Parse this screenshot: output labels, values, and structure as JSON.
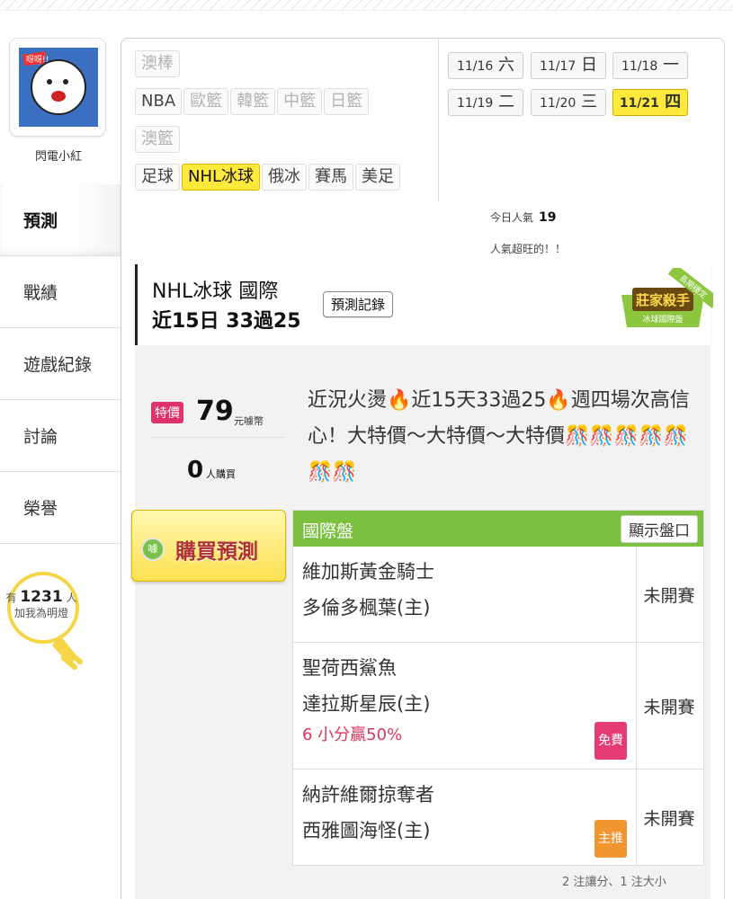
{
  "user": {
    "name": "閃電小紅"
  },
  "nav": [
    "預測",
    "戰績",
    "遊戲紀錄",
    "討論",
    "榮譽"
  ],
  "bulb": {
    "prefix": "有",
    "count": "1231",
    "suffix": "人",
    "label": "加我為明燈"
  },
  "leagues": {
    "row1": [
      "澳棒"
    ],
    "row2": [
      "NBA",
      "歐籃",
      "韓籃",
      "中籃",
      "日籃"
    ],
    "row3": [
      "澳籃"
    ],
    "row4": [
      "足球",
      "NHL冰球",
      "俄冰",
      "賽馬",
      "美足"
    ]
  },
  "dates": [
    {
      "d": "11/16",
      "w": "六"
    },
    {
      "d": "11/17",
      "w": "日"
    },
    {
      "d": "11/18",
      "w": "一"
    },
    {
      "d": "11/19",
      "w": "二"
    },
    {
      "d": "11/20",
      "w": "三"
    },
    {
      "d": "11/21",
      "w": "四"
    }
  ],
  "popularity": {
    "label": "今日人氣",
    "value": "19",
    "note": "人氣超旺的！！"
  },
  "title": {
    "line1": "NHL冰球 國際",
    "line2": "近15日 33過25",
    "record_button": "預測記錄",
    "badge_main": "莊家殺手",
    "badge_sub": "冰球國際盤",
    "badge_ribbon": "長期穩定"
  },
  "price": {
    "tag": "特價",
    "value": "79",
    "unit": "元噱幣",
    "buyers": "0",
    "buyers_unit": "人購買"
  },
  "description": "近況火燙🔥近15天33過25🔥週四場次高信心！大特價～大特價～大特價🎊🎊🎊🎊🎊🎊🎊",
  "buy_button": "購買預測",
  "table": {
    "header": "國際盤",
    "show_button": "顯示盤口",
    "rows": [
      {
        "away": "維加斯黃金騎士",
        "home": "多倫多楓葉(主)",
        "status": "未開賽",
        "pick": "",
        "tag": ""
      },
      {
        "away": "聖荷西鯊魚",
        "home": "達拉斯星辰(主)",
        "status": "未開賽",
        "pick": "6 小分贏50%",
        "tag": "免費"
      },
      {
        "away": "納許維爾掠奪者",
        "home": "西雅圖海怪(主)",
        "status": "未開賽",
        "pick": "",
        "tag": "主推"
      }
    ]
  },
  "footer": "2 注讓分、1 注大小"
}
